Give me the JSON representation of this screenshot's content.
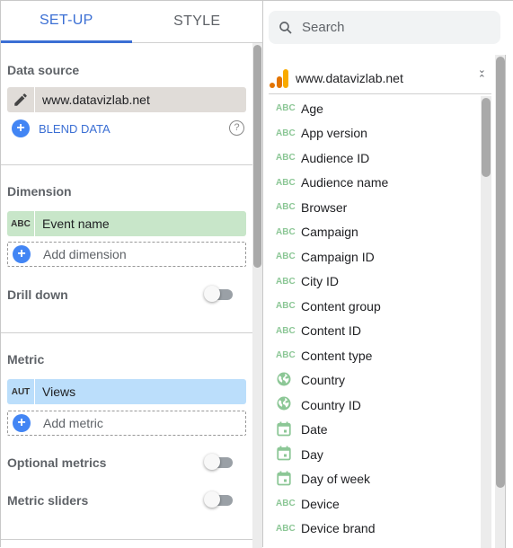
{
  "tabs": [
    {
      "label": "SET-UP",
      "active": true
    },
    {
      "label": "STYLE",
      "active": false
    }
  ],
  "data_source": {
    "title": "Data source",
    "value": "www.datavizlab.net",
    "blend_label": "BLEND DATA"
  },
  "dimension": {
    "title": "Dimension",
    "chip_type": "ABC",
    "chip_label": "Event name",
    "add_label": "Add dimension",
    "drill_down_label": "Drill down",
    "drill_down_on": false
  },
  "metric": {
    "title": "Metric",
    "chip_type": "AUT",
    "chip_label": "Views",
    "add_label": "Add metric",
    "optional_metrics_label": "Optional metrics",
    "optional_metrics_on": false,
    "metric_sliders_label": "Metric sliders",
    "metric_sliders_on": false
  },
  "search": {
    "placeholder": "Search"
  },
  "source_panel": {
    "name": "www.datavizlab.net"
  },
  "fields": [
    {
      "type": "ABC",
      "name": "Age"
    },
    {
      "type": "ABC",
      "name": "App version"
    },
    {
      "type": "ABC",
      "name": "Audience ID"
    },
    {
      "type": "ABC",
      "name": "Audience name"
    },
    {
      "type": "ABC",
      "name": "Browser"
    },
    {
      "type": "ABC",
      "name": "Campaign"
    },
    {
      "type": "ABC",
      "name": "Campaign ID"
    },
    {
      "type": "ABC",
      "name": "City ID"
    },
    {
      "type": "ABC",
      "name": "Content group"
    },
    {
      "type": "ABC",
      "name": "Content ID"
    },
    {
      "type": "ABC",
      "name": "Content type"
    },
    {
      "type": "geo",
      "name": "Country"
    },
    {
      "type": "geo",
      "name": "Country ID"
    },
    {
      "type": "date",
      "name": "Date"
    },
    {
      "type": "date",
      "name": "Day"
    },
    {
      "type": "date",
      "name": "Day of week"
    },
    {
      "type": "ABC",
      "name": "Device"
    },
    {
      "type": "ABC",
      "name": "Device brand"
    }
  ],
  "colors": {
    "accent": "#3b6fd4",
    "dimension_chip": "#c8e6c9",
    "metric_chip": "#bbdefb",
    "source_chip": "#e0dcd8",
    "field_icon": "#8cc796"
  }
}
